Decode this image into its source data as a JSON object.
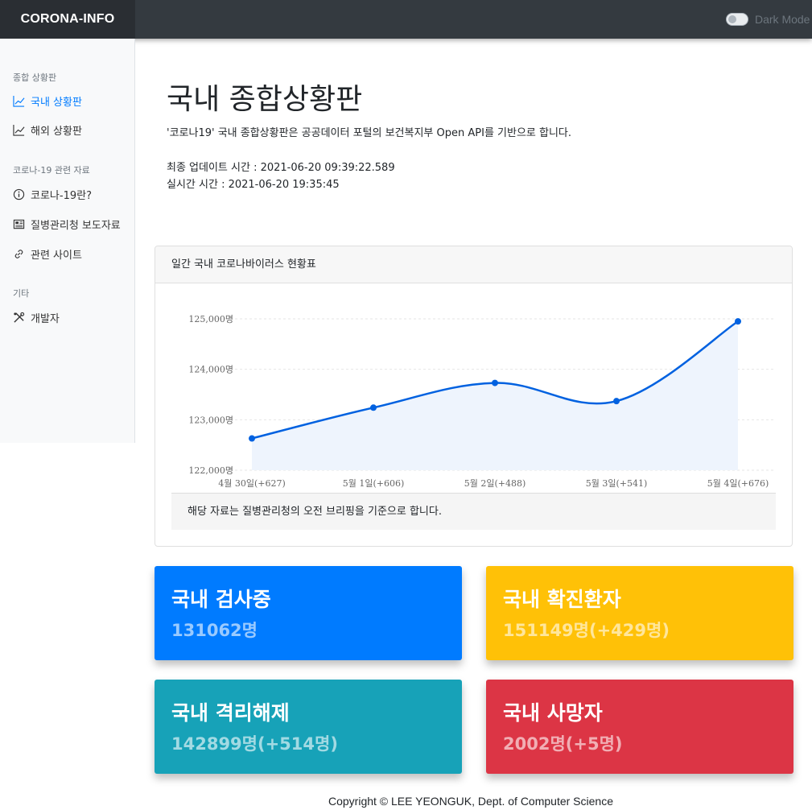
{
  "topbar": {
    "brand": "CORONA-INFO",
    "dark_mode_label": "Dark Mode"
  },
  "sidebar": {
    "sections": [
      {
        "heading": "종합 상황판",
        "items": [
          {
            "label": "국내 상황판",
            "icon": "chart-line-icon",
            "active": true
          },
          {
            "label": "해외 상황판",
            "icon": "chart-line-icon",
            "active": false
          }
        ]
      },
      {
        "heading": "코로나-19 관련 자료",
        "items": [
          {
            "label": "코로나-19란?",
            "icon": "info-circle-icon",
            "active": false
          },
          {
            "label": "질병관리청 보도자료",
            "icon": "newspaper-icon",
            "active": false
          },
          {
            "label": "관련 사이트",
            "icon": "link-icon",
            "active": false
          }
        ]
      },
      {
        "heading": "기타",
        "items": [
          {
            "label": "개발자",
            "icon": "tools-icon",
            "active": false
          }
        ]
      }
    ]
  },
  "main": {
    "title": "국내 종합상황판",
    "description": "'코로나19' 국내 종합상황판은 공공데이터 포털의 보건복지부 Open API를 기반으로 합니다.",
    "last_update": "최종 업데이트 시간 : 2021-06-20 09:39:22.589",
    "realtime": "실시간 시간 : 2021-06-20 19:35:45"
  },
  "chart_card": {
    "header": "일간 국내 코로나바이러스 현황표",
    "note": "해당 자료는 질병관리청의 오전 브리핑을 기준으로 합니다."
  },
  "chart_data": {
    "type": "line",
    "categories": [
      "4월 30일(+627)",
      "5월 1일(+606)",
      "5월 2일(+488)",
      "5월 3일(+541)",
      "5월 4일(+676)"
    ],
    "values": [
      122630,
      123240,
      123730,
      123370,
      124950
    ],
    "ylim": [
      122000,
      125000
    ],
    "yticks": [
      122000,
      123000,
      124000,
      125000
    ],
    "ytick_labels": [
      "122,000명",
      "123,000명",
      "124,000명",
      "125,000명"
    ],
    "title": "",
    "xlabel": "",
    "ylabel": "",
    "grid": true,
    "line_color": "#0061e0",
    "fill_color": "#eef4fd"
  },
  "stats": [
    {
      "title": "국내 검사중",
      "value": "131062명",
      "color": "#007bff"
    },
    {
      "title": "국내 확진환자",
      "value": "151149명(+429명)",
      "color": "#ffc107"
    },
    {
      "title": "국내 격리해제",
      "value": "142899명(+514명)",
      "color": "#17a2b8"
    },
    {
      "title": "국내 사망자",
      "value": "2002명(+5명)",
      "color": "#dc3545"
    }
  ],
  "footer": {
    "text": "Copyright © LEE YEONGUK, Dept. of Computer Science"
  }
}
